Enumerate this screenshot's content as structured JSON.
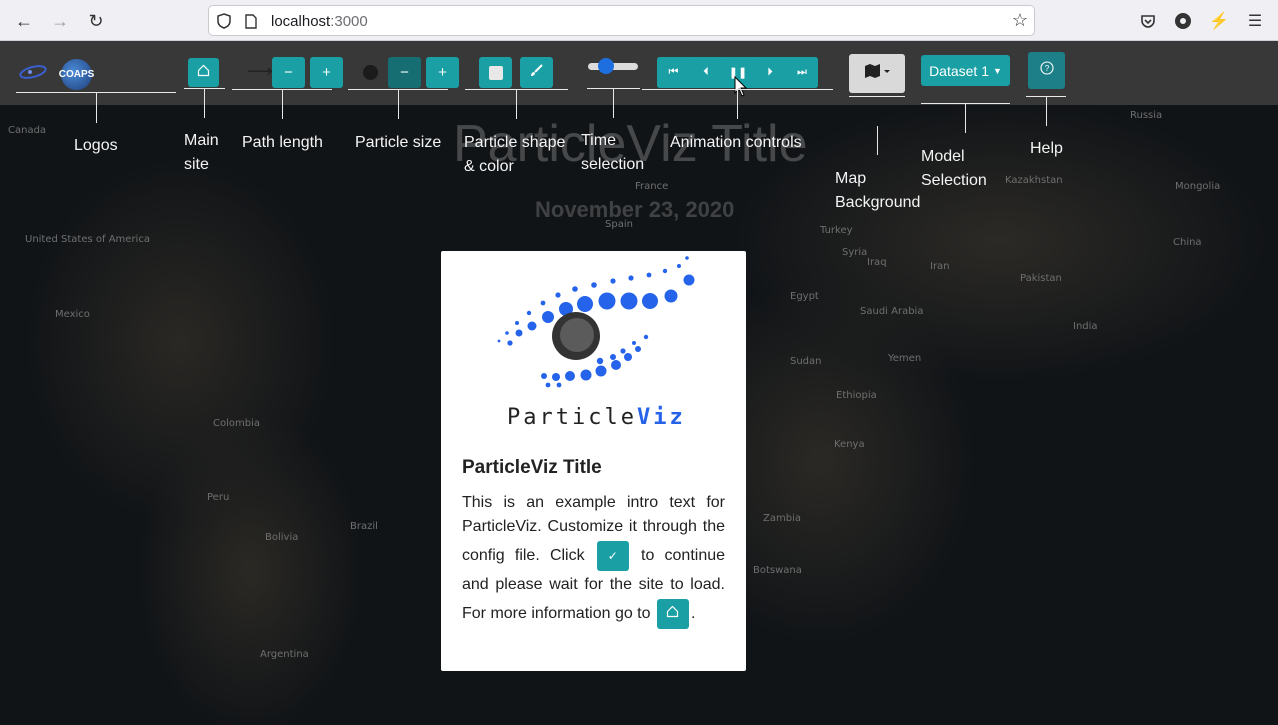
{
  "browser": {
    "url_host": "localhost",
    "url_port": ":3000"
  },
  "page": {
    "title": "ParticleViz Title",
    "date": "November 23, 2020"
  },
  "toolbar": {
    "coaps_logo_text": "COAPS",
    "dataset_label": "Dataset 1"
  },
  "annotations": {
    "logos": "Logos",
    "main_site_1": "Main",
    "main_site_2": "site",
    "path_length": "Path length",
    "particle_size": "Particle size",
    "shape_color_1": "Particle shape",
    "shape_color_2": "& color",
    "time_1": "Time",
    "time_2": "selection",
    "animation": "Animation controls",
    "map_1": "Map",
    "map_2": "Background",
    "model_1": "Model",
    "model_2": "Selection",
    "help": "Help"
  },
  "map_labels": {
    "canada": "Canada",
    "usa": "United States of America",
    "mexico": "Mexico",
    "colombia": "Colombia",
    "peru": "Peru",
    "bolivia": "Bolivia",
    "brasil": "Brazil",
    "argentina": "Argentina",
    "france": "France",
    "spain": "Spain",
    "turkey": "Turkey",
    "syria": "Syria",
    "iraq": "Iraq",
    "iran": "Iran",
    "egypt": "Egypt",
    "saudi": "Saudi Arabia",
    "yemen": "Yemen",
    "sudan": "Sudan",
    "ethiopia": "Ethiopia",
    "kenya": "Kenya",
    "zambia": "Zambia",
    "botswana": "Botswana",
    "russia": "Russia",
    "kazakhstan": "Kazakhstan",
    "mongolia": "Mongolia",
    "china": "China",
    "pakistan": "Pakistan",
    "india": "India"
  },
  "modal": {
    "logo_text_dark": "Particle",
    "logo_text_blue": "Viz",
    "heading": "ParticleViz Title",
    "text_1": "This is an example intro text for ParticleViz. Customize it through the config file. Click",
    "text_2": "to continue and please wait for the site to load. For more information go to",
    "text_3": "."
  },
  "colors": {
    "accent": "#1a9fa4",
    "logo_blue": "#2563eb"
  }
}
